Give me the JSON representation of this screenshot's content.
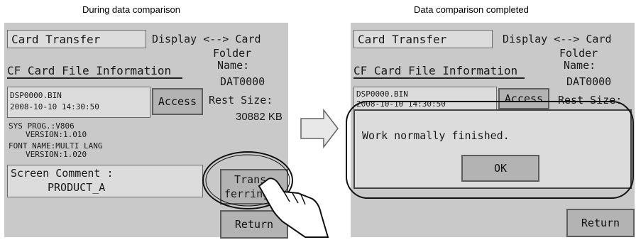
{
  "captions": {
    "left": "During data comparison",
    "right": "Data comparison completed"
  },
  "screen": {
    "title": "Card Transfer",
    "direction": "Display <--> Card",
    "folder_label_1": "Folder",
    "folder_label_2": "Name:",
    "folder_name": "DAT0000",
    "rest_label": "Rest Size:",
    "rest_value": "30882 KB",
    "info_header": "CF Card File Information",
    "file_name": "DSP0000.BIN",
    "file_date": "2008-10-10 14:30:50",
    "access": "Access",
    "sys_line1": "SYS PROG.:V806",
    "sys_line2": "VERSION:1.010",
    "font_line1": "FONT NAME:MULTI LANG",
    "font_line2": "VERSION:1.020",
    "comment_label": "Screen Comment :",
    "comment_value": "PRODUCT_A",
    "transfer_line1": "Trans-",
    "transfer_line2": "ferring...",
    "return": "Return"
  },
  "dialog": {
    "message": "Work normally finished.",
    "ok": "OK"
  }
}
